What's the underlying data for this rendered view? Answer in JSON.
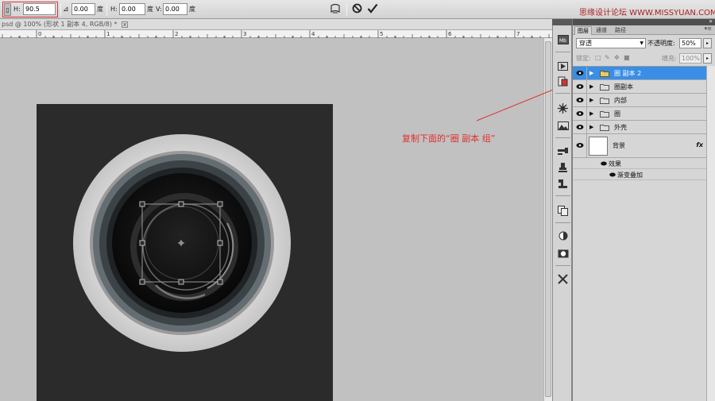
{
  "options_bar": {
    "h_label": "H:",
    "h_value": "90.5",
    "angle_value": "0.00",
    "degree": "度",
    "skew_h_label": "H:",
    "skew_h_value": "0.00",
    "skew_v_label": "V:",
    "skew_v_value": "0.00",
    "cancel_icon": "cancel-transform-icon",
    "commit_icon": "commit-transform-icon"
  },
  "watermark": "思缘设计论坛 WWW.MISSYUAN.COM",
  "document": {
    "tab_title": "psd @ 100% (形状 1 副本 4, RGB/8) *",
    "ruler_labels": [
      "0",
      "1",
      "2",
      "3",
      "4",
      "5",
      "6",
      "7"
    ]
  },
  "annotation": "复制下面的“圈  副本  组”",
  "panel": {
    "tabs": [
      "图层",
      "通道",
      "路径"
    ],
    "blend_mode": "穿透",
    "opacity_label": "不透明度:",
    "opacity_value": "50%",
    "lock_label": "锁定:",
    "fill_label": "填充:",
    "fill_value": "100%",
    "layers": [
      {
        "name": "圈 副本 2",
        "selected": true
      },
      {
        "name": "圈副本",
        "selected": false
      },
      {
        "name": "内部",
        "selected": false
      },
      {
        "name": "圈",
        "selected": false
      },
      {
        "name": "外壳",
        "selected": false
      }
    ],
    "background_layer": {
      "name": "背景",
      "fx": "fx"
    },
    "effects_label": "效果",
    "gradient_overlay_label": "渐变叠加"
  },
  "colors": {
    "selection": "#3a8ee6",
    "annotation": "#e03030",
    "canvas": "#2a2a2a"
  }
}
